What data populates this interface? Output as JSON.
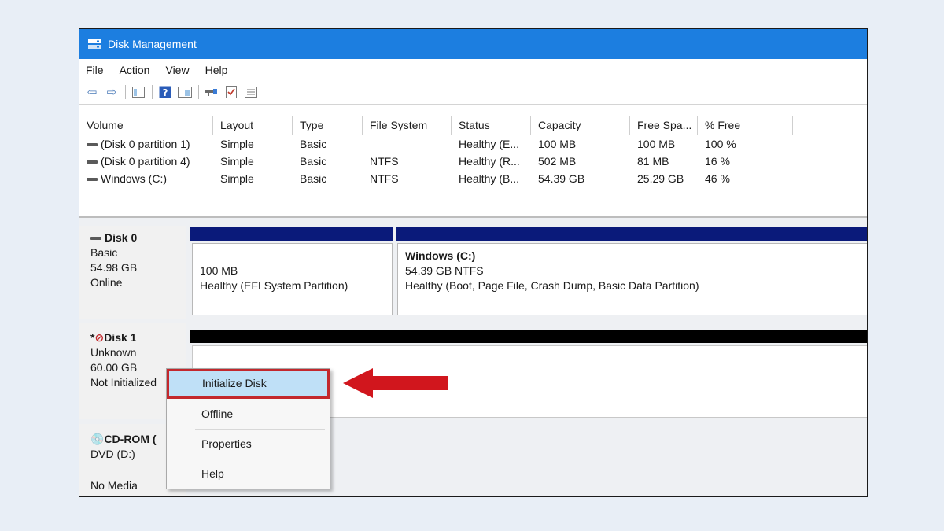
{
  "window": {
    "title": "Disk Management",
    "accent": "#1c7ee0"
  },
  "menubar": [
    "File",
    "Action",
    "View",
    "Help"
  ],
  "toolbar": {
    "icons": [
      "back-icon",
      "forward-icon",
      "console-tree-icon",
      "help-icon",
      "properties-view-icon",
      "connect-icon",
      "checklist-icon",
      "list-icon"
    ]
  },
  "volume_table": {
    "headers": [
      "Volume",
      "Layout",
      "Type",
      "File System",
      "Status",
      "Capacity",
      "Free Spa...",
      "% Free"
    ],
    "rows": [
      [
        "(Disk 0 partition 1)",
        "Simple",
        "Basic",
        "",
        "Healthy (E...",
        "100 MB",
        "100 MB",
        "100 %"
      ],
      [
        "(Disk 0 partition 4)",
        "Simple",
        "Basic",
        "NTFS",
        "Healthy (R...",
        "502 MB",
        "81 MB",
        "16 %"
      ],
      [
        "Windows (C:)",
        "Simple",
        "Basic",
        "NTFS",
        "Healthy (B...",
        "54.39 GB",
        "25.29 GB",
        "46 %"
      ]
    ]
  },
  "disks": {
    "disk0": {
      "name": "Disk 0",
      "type": "Basic",
      "size": "54.98 GB",
      "status": "Online",
      "partitions": [
        {
          "name": "",
          "size": "100 MB",
          "status": "Healthy (EFI System Partition)"
        },
        {
          "name": "Windows  (C:)",
          "size": "54.39 GB NTFS",
          "status": "Healthy (Boot, Page File, Crash Dump, Basic Data Partition)"
        }
      ]
    },
    "disk1": {
      "name": "Disk 1",
      "marker": "*",
      "type": "Unknown",
      "size": "60.00 GB",
      "status": "Not Initialized"
    },
    "cdrom": {
      "name": "CD-ROM (",
      "drive": "DVD (D:)",
      "status": "No Media"
    }
  },
  "context_menu": {
    "items": [
      "Initialize Disk",
      "Offline",
      "Properties",
      "Help"
    ],
    "highlighted": "Initialize Disk",
    "highlight_color": "#c3282d"
  },
  "colors": {
    "partition_bar": "#0a1a7a",
    "unallocated_bar": "#000000",
    "arrow": "#d1161d"
  }
}
